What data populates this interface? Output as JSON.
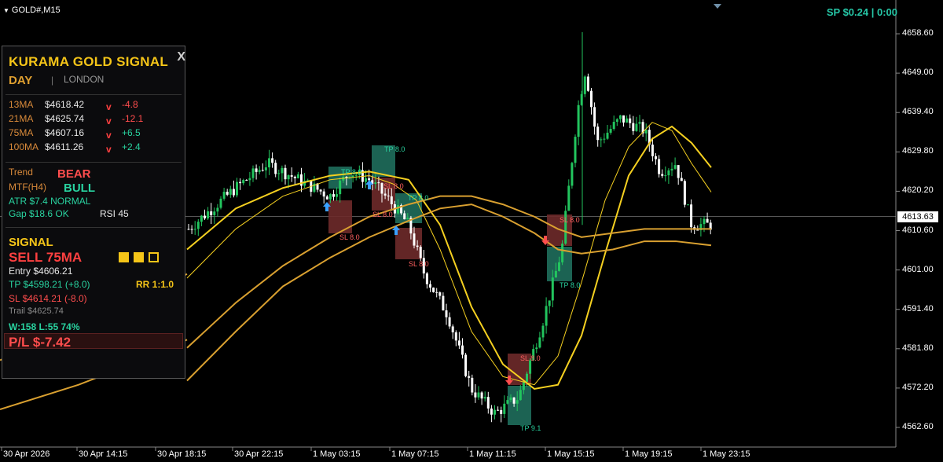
{
  "symbol_label": "GOLD#,M15",
  "spread_text": "SP $0.24  |  0:00",
  "current_price": "4613.63",
  "y_axis": {
    "ticks": [
      "4658.60",
      "4649.00",
      "4639.40",
      "4629.80",
      "4620.20",
      "4610.60",
      "4601.00",
      "4591.40",
      "4581.80",
      "4572.20",
      "4562.60"
    ],
    "tick_values": [
      4658.6,
      4649.0,
      4639.4,
      4629.8,
      4620.2,
      4610.6,
      4601.0,
      4591.4,
      4581.8,
      4572.2,
      4562.6
    ]
  },
  "x_axis": {
    "ticks": [
      "30 Apr 2026",
      "30 Apr 14:15",
      "30 Apr 18:15",
      "30 Apr 22:15",
      "1 May 03:15",
      "1 May 07:15",
      "1 May 11:15",
      "1 May 15:15",
      "1 May 19:15",
      "1 May 23:15"
    ]
  },
  "chart_marks": {
    "tp_labels": [
      "TP 8.0",
      "TP 8.0",
      "TP 8.0",
      "TP 9.1",
      "TP 8.0"
    ],
    "sl_labels": [
      "SL 8.0",
      "SL 8.0",
      "SL 8.0",
      "SL 8.0",
      "SL 8.0",
      "SL 8.0"
    ]
  },
  "panel": {
    "title": "KURAMA GOLD SIGNAL",
    "close": "X",
    "session_day": "DAY",
    "session_sep": "|",
    "session_city": "LONDON",
    "ma": [
      {
        "name": "13MA",
        "value": "$4618.42",
        "dir": "v",
        "change": "-4.8",
        "tone": "neg"
      },
      {
        "name": "21MA",
        "value": "$4625.74",
        "dir": "v",
        "change": "-12.1",
        "tone": "neg"
      },
      {
        "name": "75MA",
        "value": "$4607.16",
        "dir": "v",
        "change": "+6.5",
        "tone": "pos"
      },
      {
        "name": "100MA",
        "value": "$4611.26",
        "dir": "v",
        "change": "+2.4",
        "tone": "pos"
      }
    ],
    "trend_label": "Trend",
    "trend_value": "BEAR",
    "mtf_label": "MTF(H4)",
    "mtf_value": "BULL",
    "atr": "ATR  $7.4  NORMAL",
    "gap": "Gap $18.6 OK",
    "rsi": "RSI 45",
    "signal_title": "SIGNAL",
    "signal_main": "SELL  75MA",
    "strength": [
      true,
      true,
      false
    ],
    "entry": "Entry  $4606.21",
    "tp": "TP  $4598.21  (+8.0)",
    "rr": "RR 1:1.0",
    "sl": "SL  $4614.21  (-8.0)",
    "trail": "Trail  $4625.74",
    "winloss": "W:158 L:55  74%",
    "pl": "P/L  $-7.42"
  },
  "colors": {
    "bull_candle": "#22c55e",
    "bear_candle": "#ffffff",
    "ma_fast": "#f5d020",
    "ma_slow": "#d9a030",
    "tp_box": "#1f6e5c",
    "sl_box": "#6e2a2a",
    "accent": "#29d3a0"
  }
}
